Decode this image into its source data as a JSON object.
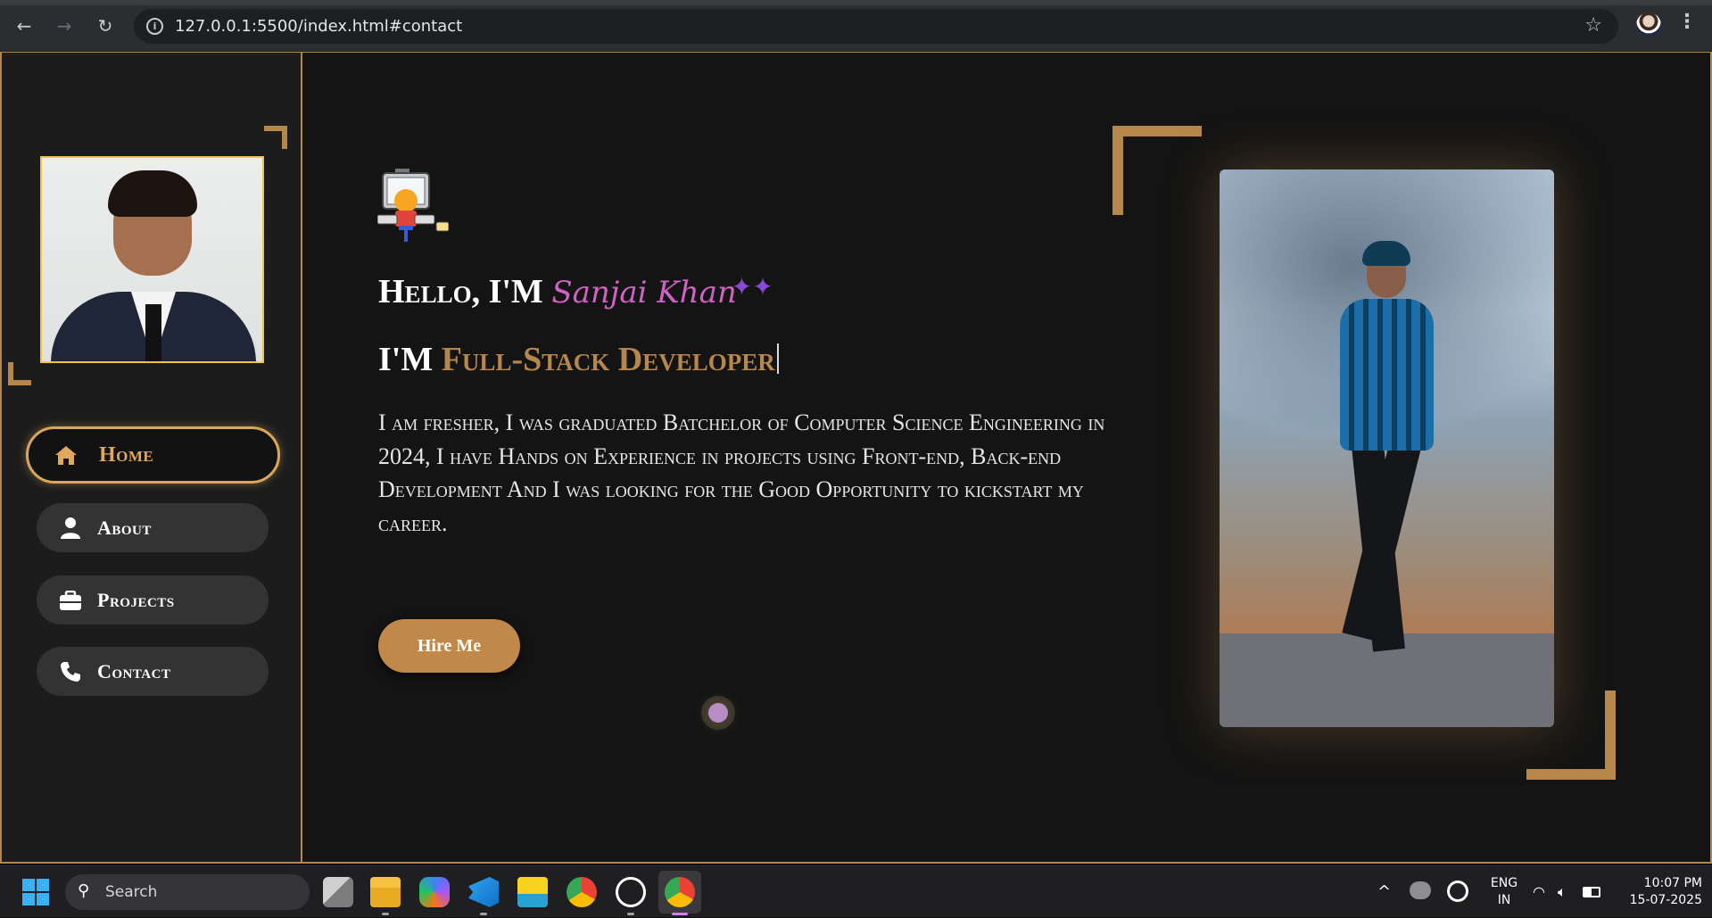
{
  "browser": {
    "url": "127.0.0.1:5500/index.html#contact",
    "back_icon": "←",
    "forward_icon": "→",
    "reload_icon": "↻",
    "info_icon": "i",
    "star_icon": "☆",
    "menu_icon": "⋮"
  },
  "sidebar": {
    "items": [
      {
        "label": "Home",
        "icon": "home-icon",
        "active": true
      },
      {
        "label": "About",
        "icon": "user-icon",
        "active": false
      },
      {
        "label": "Projects",
        "icon": "briefcase-icon",
        "active": false
      },
      {
        "label": "Contact",
        "icon": "phone-icon",
        "active": false
      }
    ]
  },
  "hero": {
    "hello_prefix": "Hello, I'M ",
    "name": "Sanjai Khan",
    "sparkle": "✦✦",
    "role_prefix": "I'M ",
    "role": "Full-Stack Developer",
    "bio": "I am fresher, I was graduated Batchelor of Computer Science Engineering in 2024, I have Hands on Experience in projects using Front-end, Back-end Development And I was looking for the Good Opportunity to kickstart my career.",
    "cta_label": "Hire Me"
  },
  "colors": {
    "accent": "#b5874a",
    "active_nav_text": "#e0a85c",
    "name_color": "#d062c4",
    "background": "#141414",
    "sidebar_bg": "#1c1c1c"
  },
  "taskbar": {
    "search_label": "Search",
    "search_icon": "⚲",
    "lang_line1": "ENG",
    "lang_line2": "IN",
    "time": "10:07 PM",
    "date": "15-07-2025",
    "tray_chevron": "^",
    "apps": [
      "task-view-icon",
      "file-explorer-icon",
      "copilot-icon",
      "vscode-icon",
      "app-icon",
      "chrome-icon",
      "chatgpt-icon",
      "chrome-profile-icon"
    ]
  }
}
